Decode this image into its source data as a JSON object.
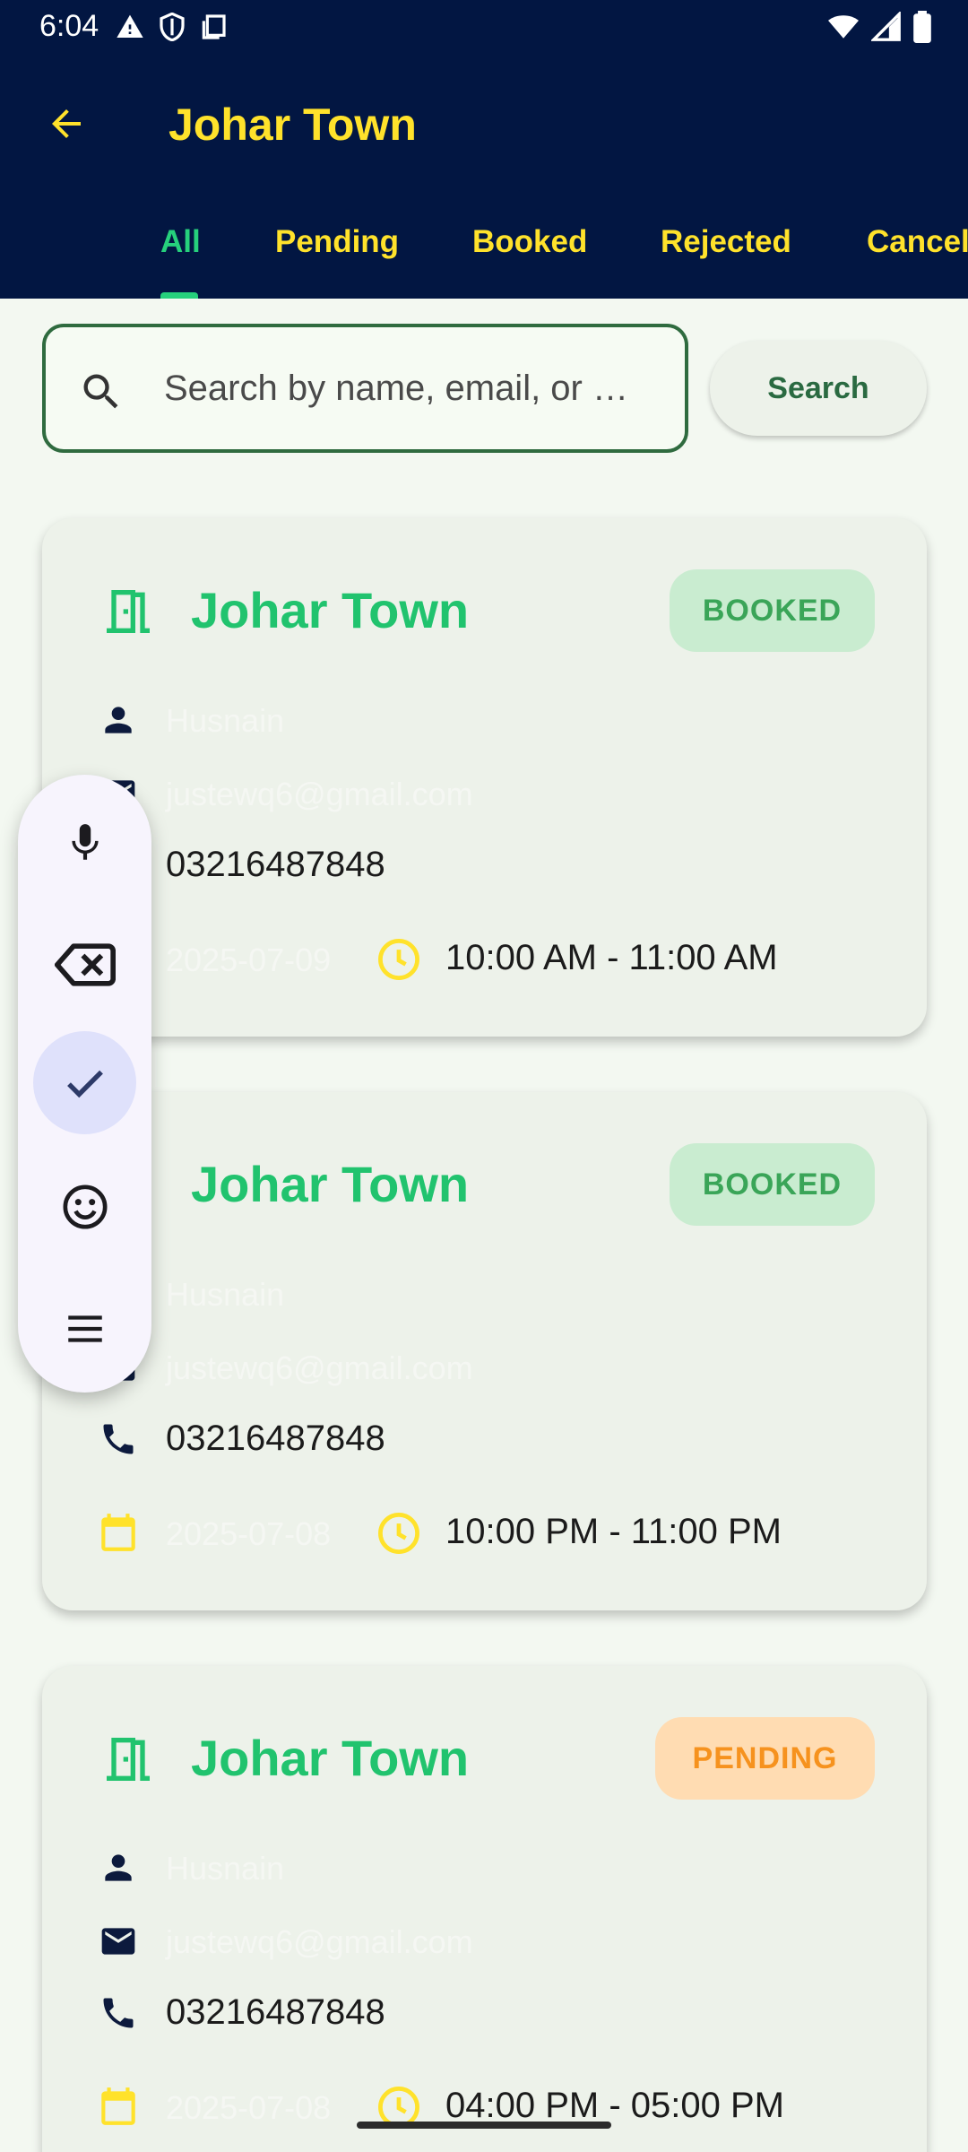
{
  "status_bar": {
    "time": "6:04"
  },
  "app_bar": {
    "title": "Johar Town"
  },
  "tabs": [
    {
      "label": "All",
      "active": true
    },
    {
      "label": "Pending"
    },
    {
      "label": "Booked"
    },
    {
      "label": "Rejected"
    },
    {
      "label": "Cancel"
    }
  ],
  "search": {
    "placeholder": "Search by name, email, or …",
    "value": "",
    "button_label": "Search"
  },
  "bookings": [
    {
      "title": "Johar Town",
      "status": "BOOKED",
      "name": "Husnain",
      "email": "justewq6@gmail.com",
      "phone": "03216487848",
      "date": "2025-07-09",
      "time": "10:00 AM - 11:00 AM"
    },
    {
      "title": "Johar Town",
      "status": "BOOKED",
      "name": "Husnain",
      "email": "justewq6@gmail.com",
      "phone": "03216487848",
      "date": "2025-07-08",
      "time": "10:00 PM - 11:00 PM"
    },
    {
      "title": "Johar Town",
      "status": "PENDING",
      "name": "Husnain",
      "email": "justewq6@gmail.com",
      "phone": "03216487848",
      "date": "2025-07-08",
      "time": "04:00 PM - 05:00 PM"
    }
  ],
  "keyboard_toolbar": {
    "buttons": [
      "mic-icon",
      "backspace-icon",
      "check-icon",
      "emoji-icon",
      "menu-icon"
    ],
    "selected": "check-icon"
  },
  "colors": {
    "header_bg": "#021642",
    "accent_yellow": "#ffe22b",
    "accent_green": "#21c36e",
    "booked_badge_bg": "#c9ecd0",
    "pending_badge_bg": "#ffdcb2"
  }
}
